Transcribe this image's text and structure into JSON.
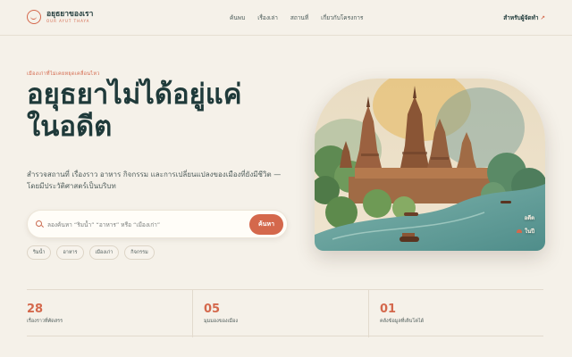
{
  "brand": {
    "title": "อยุธยาของเรา",
    "subtitle": "OUR AYUT THAYA"
  },
  "nav": {
    "links": [
      "ค้นพบ",
      "เรื่องเล่า",
      "สถานที่",
      "เกี่ยวกับโครงการ"
    ],
    "cta": "สำหรับผู้จัดทำ",
    "cta_icon": "arrow-up-right-icon"
  },
  "hero": {
    "eyebrow": "เมืองเก่าที่ไม่เคยหยุดเคลื่อนไหว",
    "title_line1": "อยุธยาไม่ได้อยู่แค่",
    "title_line2": "ในอดีต",
    "description": "สำรวจสถานที่ เรื่องราว อาหาร กิจกรรม และการเปลี่ยนแปลงของเมืองที่ยังมีชีวิต — โดยมีประวัติศาสตร์เป็นบริบท"
  },
  "search": {
    "placeholder": "ลองค้นหา “ริมน้ำ” “อาหาร” หรือ “เมืองเก่า”",
    "value": "",
    "button_label": "ค้นหา"
  },
  "tags": [
    "ริมน้ำ",
    "อาหาร",
    "เมืองเก่า",
    "กิจกรรม"
  ],
  "image_caption": {
    "line1": "อดีต",
    "line2": "ในปี"
  },
  "stats": [
    {
      "value": "28",
      "label": "เรื่องราวที่คัดสรร"
    },
    {
      "value": "05",
      "label": "มุมมองของเมือง"
    },
    {
      "value": "01",
      "label": "คลังข้อมูลที่เติบโตได้"
    }
  ],
  "colors": {
    "background": "#f5f1e9",
    "accent": "#d4684c",
    "text": "#1f3a3a"
  }
}
